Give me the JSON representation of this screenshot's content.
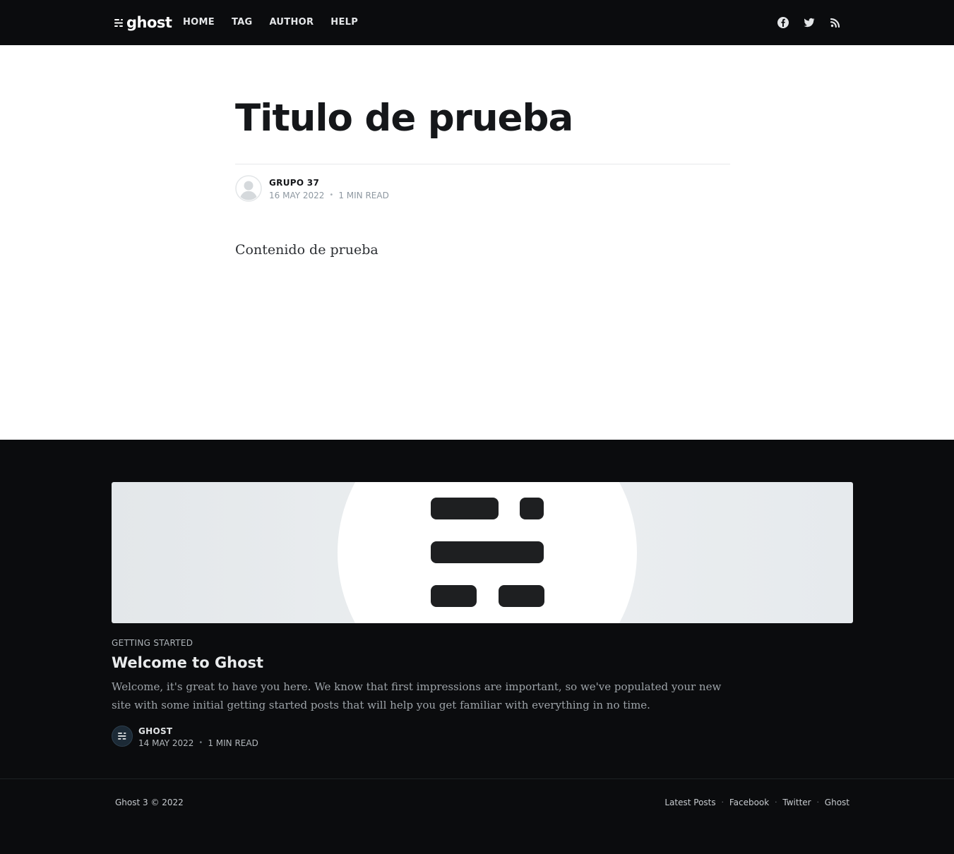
{
  "nav": {
    "logo_text": "ghost",
    "links": [
      {
        "label": "HOME"
      },
      {
        "label": "TAG"
      },
      {
        "label": "AUTHOR"
      },
      {
        "label": "HELP"
      }
    ],
    "social": [
      "facebook-icon",
      "twitter-icon",
      "rss-icon"
    ]
  },
  "post": {
    "title": "Titulo de prueba",
    "author": "GRUPO 37",
    "date": "16 MAY 2022",
    "read_time": "1 MIN READ",
    "content": "Contenido de prueba"
  },
  "related": {
    "tag": "GETTING STARTED",
    "title": "Welcome to Ghost",
    "excerpt": "Welcome, it's great to have you here. We know that first impressions are important, so we've populated your new site with some initial getting started posts that will help you get familiar with everything in no time.",
    "author": "GHOST",
    "date": "14 MAY 2022",
    "read_time": "1 MIN READ"
  },
  "footer": {
    "copyright": "Ghost 3 © 2022",
    "links": [
      {
        "label": "Latest Posts"
      },
      {
        "label": "Facebook"
      },
      {
        "label": "Twitter"
      },
      {
        "label": "Ghost"
      }
    ],
    "separator": "·"
  },
  "colors": {
    "nav_bg": "#0b0c0e",
    "body_bg": "#ffffff",
    "footer_bg": "#0b0c0e",
    "text_dark": "#15171a",
    "meta_gray": "#8e98a1"
  }
}
